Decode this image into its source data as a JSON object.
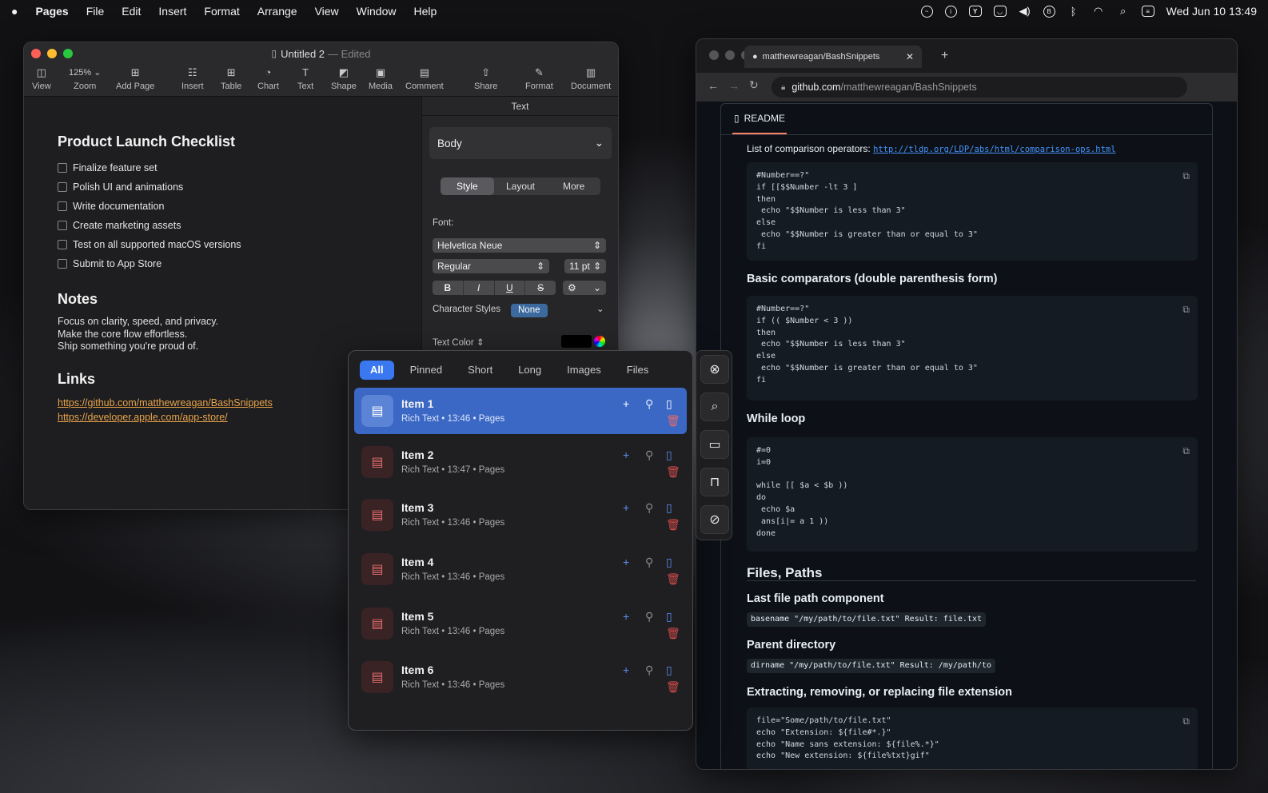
{
  "menubar": {
    "apple": "",
    "app": "Pages",
    "menus": [
      "File",
      "Edit",
      "Insert",
      "Format",
      "Arrange",
      "View",
      "Window",
      "Help"
    ],
    "clock": "Wed Jun 10  13:49",
    "status_icons": [
      "messenger-icon",
      "info-icon",
      "y-icon",
      "smile-icon",
      "volume-icon",
      "b-icon",
      "bluetooth-icon",
      "wifi-icon",
      "search-icon",
      "control-center-icon"
    ]
  },
  "pages": {
    "title": "Untitled 2",
    "edited": "— Edited",
    "toolbar": {
      "view": "View",
      "zoom_value": "125%",
      "zoom": "Zoom",
      "add_page": "Add Page",
      "insert": "Insert",
      "table": "Table",
      "chart": "Chart",
      "text": "Text",
      "shape": "Shape",
      "media": "Media",
      "comment": "Comment",
      "share": "Share",
      "format": "Format",
      "document": "Document"
    },
    "doc": {
      "checklist_title": "Product Launch Checklist",
      "checklist": [
        "Finalize feature set",
        "Polish UI and animations",
        "Write documentation",
        "Create marketing assets",
        "Test on all supported macOS versions",
        "Submit to App Store"
      ],
      "notes_title": "Notes",
      "notes": [
        "Focus on clarity, speed, and privacy.",
        "Make the core flow effortless.",
        "Ship something you're proud of."
      ],
      "links_title": "Links",
      "links": [
        "https://github.com/matthewreagan/BashSnippets",
        "https://developer.apple.com/app-store/"
      ]
    },
    "inspector": {
      "header": "Text",
      "paragraph_style": "Body",
      "tabs": [
        "Style",
        "Layout",
        "More"
      ],
      "font_label": "Font:",
      "font_family": "Helvetica Neue",
      "font_weight": "Regular",
      "font_size": "11 pt",
      "format_buttons": [
        "B",
        "I",
        "U",
        "S"
      ],
      "character_styles_label": "Character Styles",
      "character_style": "None",
      "text_color_label": "Text Color"
    }
  },
  "clipboard": {
    "tabs": [
      "All",
      "Pinned",
      "Short",
      "Long",
      "Images",
      "Files"
    ],
    "items": [
      {
        "title": "Item 1",
        "sub": "Rich Text  •  13:46  •  Pages"
      },
      {
        "title": "Item 2",
        "sub": "Rich Text  •  13:47  •  Pages"
      },
      {
        "title": "Item 3",
        "sub": "Rich Text  •  13:46  •  Pages"
      },
      {
        "title": "Item 4",
        "sub": "Rich Text  •  13:46  •  Pages"
      },
      {
        "title": "Item 5",
        "sub": "Rich Text  •  13:46  •  Pages"
      },
      {
        "title": "Item 6",
        "sub": "Rich Text  •  13:46  •  Pages"
      }
    ]
  },
  "strip": {
    "buttons": [
      "close-circle-icon",
      "search-icon",
      "folder-icon",
      "unlock-icon",
      "hidden-eye-icon"
    ]
  },
  "browser": {
    "tab_title": "matthewreagan/BashSnippets",
    "url_host": "github.com",
    "url_path": "/matthewreagan/BashSnippets",
    "readme": "README",
    "comparison_text": "List of comparison operators:",
    "comparison_link": "http://tldp.org/LDP/abs/html/comparison-ops.html",
    "code1": "#Number==?\"\nif [[$$Number -lt 3 ]\nthen\n echo \"$$Number is less than 3\"\nelse\n echo \"$$Number is greater than or equal to 3\"\nfi",
    "h_basic": "Basic comparators (double parenthesis form)",
    "code2": "#Number==?\"\nif (( $Number < 3 ))\nthen\n echo \"$$Number is less than 3\"\nelse\n echo \"$$Number is greater than or equal to 3\"\nfi",
    "h_while": "While loop",
    "code3": "#=0\ni=0\n\nwhile [[ $a < $b ))\ndo\n echo $a\n ans[i|= a 1 ))\ndone",
    "h_files": "Files, Paths",
    "h_last": "Last file path component",
    "code4": "basename \"/my/path/to/file.txt\" Result: file.txt",
    "h_parent": "Parent directory",
    "code5": "dirname \"/my/path/to/file.txt\" Result: /my/path/to",
    "h_ext": "Extracting, removing, or replacing file extension",
    "code6": "file=\"Some/path/to/file.txt\"\necho \"Extension: ${file#*.}\"\necho \"Name sans extension: ${file%.*}\"\necho \"New extension: ${file%txt}gif\""
  }
}
